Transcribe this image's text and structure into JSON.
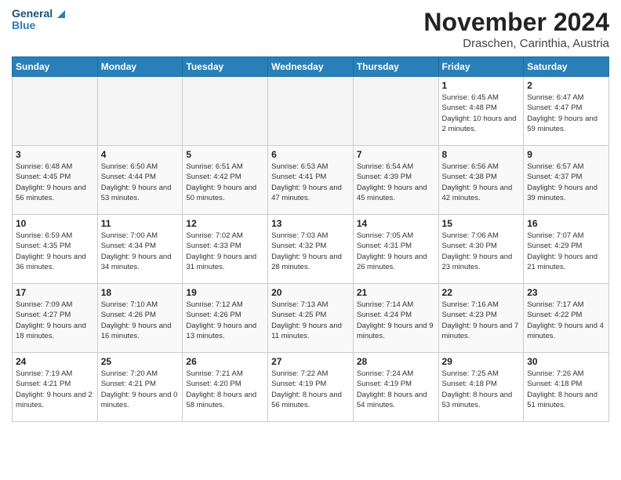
{
  "header": {
    "logo_text_general": "General",
    "logo_text_blue": "Blue",
    "month_title": "November 2024",
    "subtitle": "Draschen, Carinthia, Austria"
  },
  "days_of_week": [
    "Sunday",
    "Monday",
    "Tuesday",
    "Wednesday",
    "Thursday",
    "Friday",
    "Saturday"
  ],
  "weeks": [
    [
      {
        "day": "",
        "info": ""
      },
      {
        "day": "",
        "info": ""
      },
      {
        "day": "",
        "info": ""
      },
      {
        "day": "",
        "info": ""
      },
      {
        "day": "",
        "info": ""
      },
      {
        "day": "1",
        "info": "Sunrise: 6:45 AM\nSunset: 4:48 PM\nDaylight: 10 hours and 2 minutes."
      },
      {
        "day": "2",
        "info": "Sunrise: 6:47 AM\nSunset: 4:47 PM\nDaylight: 9 hours and 59 minutes."
      }
    ],
    [
      {
        "day": "3",
        "info": "Sunrise: 6:48 AM\nSunset: 4:45 PM\nDaylight: 9 hours and 56 minutes."
      },
      {
        "day": "4",
        "info": "Sunrise: 6:50 AM\nSunset: 4:44 PM\nDaylight: 9 hours and 53 minutes."
      },
      {
        "day": "5",
        "info": "Sunrise: 6:51 AM\nSunset: 4:42 PM\nDaylight: 9 hours and 50 minutes."
      },
      {
        "day": "6",
        "info": "Sunrise: 6:53 AM\nSunset: 4:41 PM\nDaylight: 9 hours and 47 minutes."
      },
      {
        "day": "7",
        "info": "Sunrise: 6:54 AM\nSunset: 4:39 PM\nDaylight: 9 hours and 45 minutes."
      },
      {
        "day": "8",
        "info": "Sunrise: 6:56 AM\nSunset: 4:38 PM\nDaylight: 9 hours and 42 minutes."
      },
      {
        "day": "9",
        "info": "Sunrise: 6:57 AM\nSunset: 4:37 PM\nDaylight: 9 hours and 39 minutes."
      }
    ],
    [
      {
        "day": "10",
        "info": "Sunrise: 6:59 AM\nSunset: 4:35 PM\nDaylight: 9 hours and 36 minutes."
      },
      {
        "day": "11",
        "info": "Sunrise: 7:00 AM\nSunset: 4:34 PM\nDaylight: 9 hours and 34 minutes."
      },
      {
        "day": "12",
        "info": "Sunrise: 7:02 AM\nSunset: 4:33 PM\nDaylight: 9 hours and 31 minutes."
      },
      {
        "day": "13",
        "info": "Sunrise: 7:03 AM\nSunset: 4:32 PM\nDaylight: 9 hours and 28 minutes."
      },
      {
        "day": "14",
        "info": "Sunrise: 7:05 AM\nSunset: 4:31 PM\nDaylight: 9 hours and 26 minutes."
      },
      {
        "day": "15",
        "info": "Sunrise: 7:06 AM\nSunset: 4:30 PM\nDaylight: 9 hours and 23 minutes."
      },
      {
        "day": "16",
        "info": "Sunrise: 7:07 AM\nSunset: 4:29 PM\nDaylight: 9 hours and 21 minutes."
      }
    ],
    [
      {
        "day": "17",
        "info": "Sunrise: 7:09 AM\nSunset: 4:27 PM\nDaylight: 9 hours and 18 minutes."
      },
      {
        "day": "18",
        "info": "Sunrise: 7:10 AM\nSunset: 4:26 PM\nDaylight: 9 hours and 16 minutes."
      },
      {
        "day": "19",
        "info": "Sunrise: 7:12 AM\nSunset: 4:26 PM\nDaylight: 9 hours and 13 minutes."
      },
      {
        "day": "20",
        "info": "Sunrise: 7:13 AM\nSunset: 4:25 PM\nDaylight: 9 hours and 11 minutes."
      },
      {
        "day": "21",
        "info": "Sunrise: 7:14 AM\nSunset: 4:24 PM\nDaylight: 9 hours and 9 minutes."
      },
      {
        "day": "22",
        "info": "Sunrise: 7:16 AM\nSunset: 4:23 PM\nDaylight: 9 hours and 7 minutes."
      },
      {
        "day": "23",
        "info": "Sunrise: 7:17 AM\nSunset: 4:22 PM\nDaylight: 9 hours and 4 minutes."
      }
    ],
    [
      {
        "day": "24",
        "info": "Sunrise: 7:19 AM\nSunset: 4:21 PM\nDaylight: 9 hours and 2 minutes."
      },
      {
        "day": "25",
        "info": "Sunrise: 7:20 AM\nSunset: 4:21 PM\nDaylight: 9 hours and 0 minutes."
      },
      {
        "day": "26",
        "info": "Sunrise: 7:21 AM\nSunset: 4:20 PM\nDaylight: 8 hours and 58 minutes."
      },
      {
        "day": "27",
        "info": "Sunrise: 7:22 AM\nSunset: 4:19 PM\nDaylight: 8 hours and 56 minutes."
      },
      {
        "day": "28",
        "info": "Sunrise: 7:24 AM\nSunset: 4:19 PM\nDaylight: 8 hours and 54 minutes."
      },
      {
        "day": "29",
        "info": "Sunrise: 7:25 AM\nSunset: 4:18 PM\nDaylight: 8 hours and 53 minutes."
      },
      {
        "day": "30",
        "info": "Sunrise: 7:26 AM\nSunset: 4:18 PM\nDaylight: 8 hours and 51 minutes."
      }
    ]
  ]
}
